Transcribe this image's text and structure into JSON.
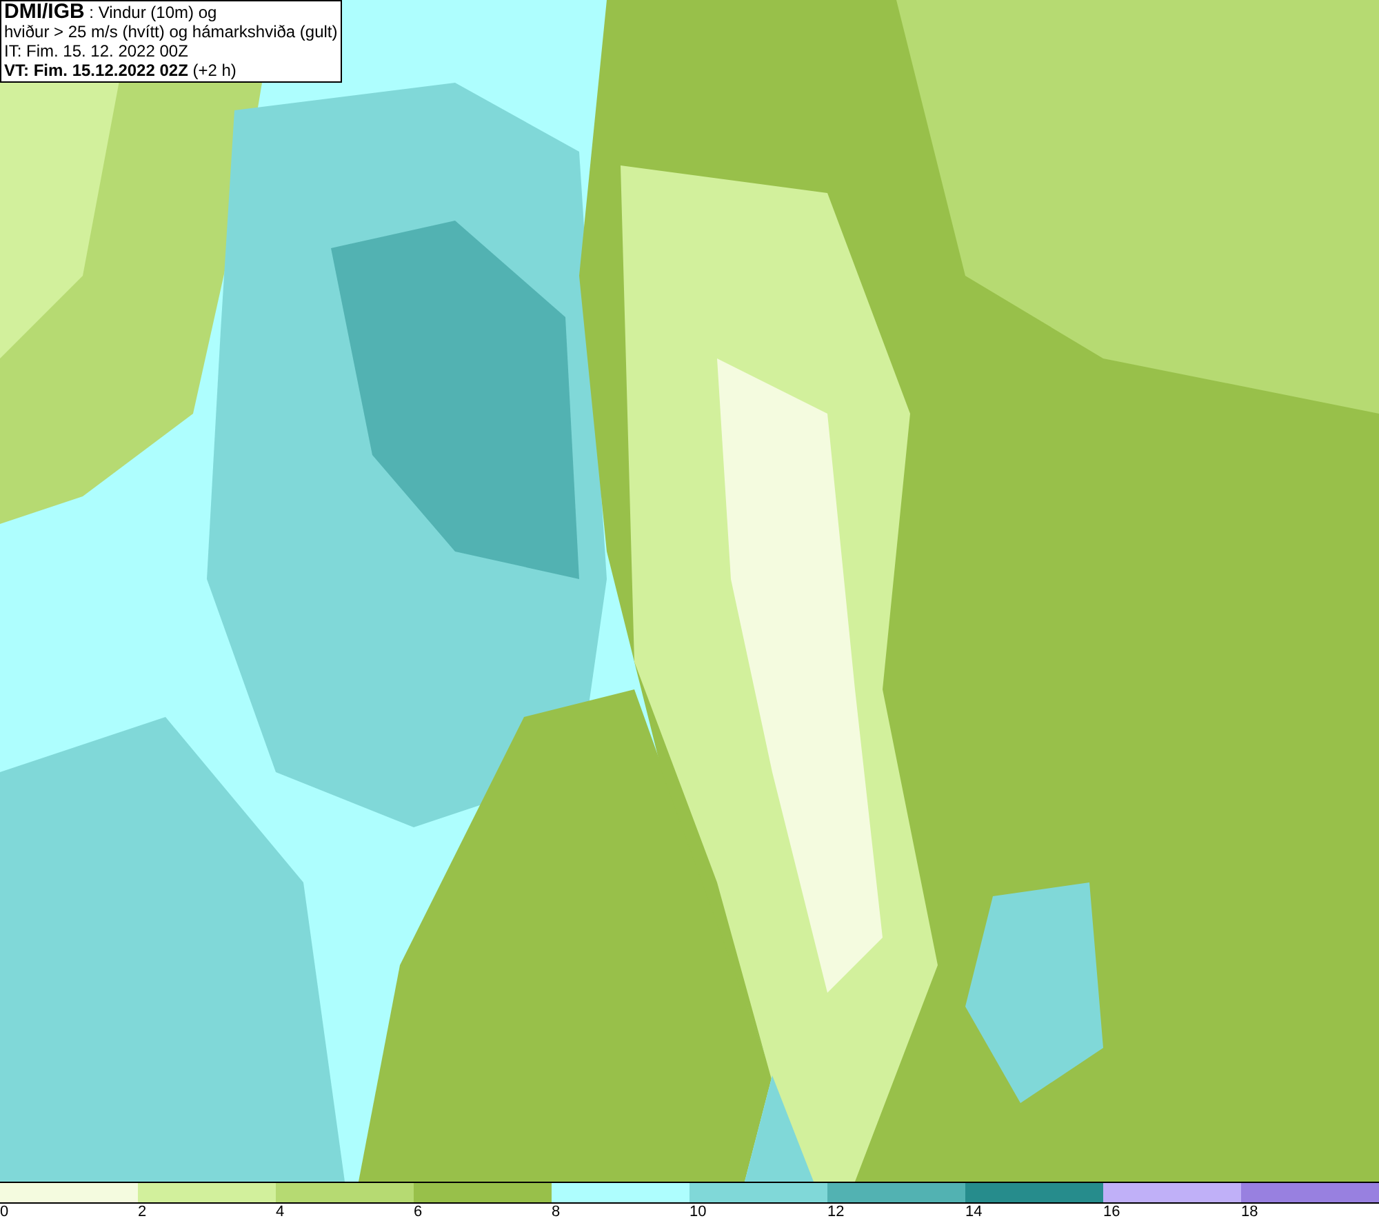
{
  "title_box": {
    "lines": [
      "**DMI/IGB** : Vindur (10m) og",
      "hviður > 25 m/s (hvítt) og hámarkshviða (gult)",
      "IT: Fim. 15. 12. 2022 00Z",
      "**VT: Fim. 15.12.2022 02Z** (+2 h)"
    ]
  },
  "legend": [
    {
      "color": "#f4fbdf",
      "label": "0"
    },
    {
      "color": "#d2f09c",
      "label": "2"
    },
    {
      "color": "#b6da72",
      "label": "4"
    },
    {
      "color": "#98c04a",
      "label": "6"
    },
    {
      "color": "#aefefe",
      "label": "8"
    },
    {
      "color": "#80d8d8",
      "label": "10"
    },
    {
      "color": "#52b2b2",
      "label": "12"
    },
    {
      "color": "#268c8c",
      "label": "14"
    },
    {
      "color": "#c0b0f8",
      "label": "16"
    },
    {
      "color": "#9880e0",
      "label": "18"
    }
  ]
}
